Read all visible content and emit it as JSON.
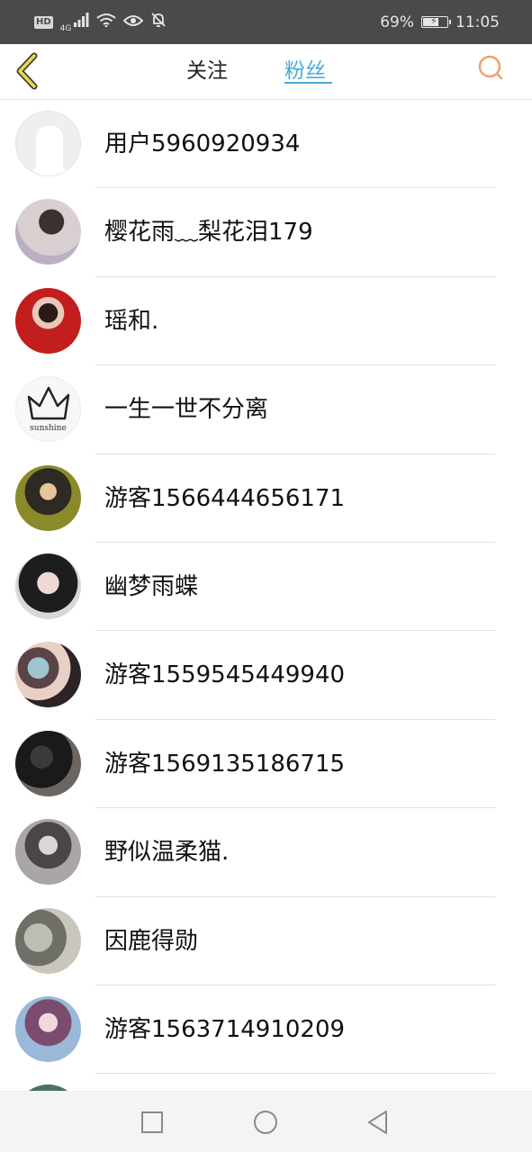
{
  "status_bar": {
    "left_badge": "HD",
    "network": "4G",
    "battery": "69%",
    "battery_fraction": 0.69,
    "time": "11:05",
    "icons": [
      "hd-icon",
      "signal-icon",
      "wifi-icon",
      "eye-icon",
      "mute-bell-icon",
      "battery-icon"
    ]
  },
  "nav": {
    "back_icon": "chevron-left-icon",
    "tabs": [
      {
        "label": "关注",
        "active": false
      },
      {
        "label": "粉丝",
        "active": true
      }
    ],
    "search_icon": "search-icon",
    "accent_color": "#4aaad7",
    "back_color": "#e8d94a",
    "search_color": "#f0a070"
  },
  "fans": [
    {
      "name": "用户5960920934",
      "avatar": "default-avatar-icon"
    },
    {
      "name": "樱花雨﹏梨花泪179",
      "avatar": "user-avatar"
    },
    {
      "name": "瑶和.",
      "avatar": "user-avatar"
    },
    {
      "name": "一生一世不分离",
      "avatar": "crown-avatar",
      "avatar_text": "sunshine"
    },
    {
      "name": "游客1566444656171",
      "avatar": "user-avatar"
    },
    {
      "name": "幽梦雨蝶",
      "avatar": "user-avatar"
    },
    {
      "name": "游客1559545449940",
      "avatar": "user-avatar"
    },
    {
      "name": "游客1569135186715",
      "avatar": "user-avatar"
    },
    {
      "name": "野似温柔猫.",
      "avatar": "user-avatar"
    },
    {
      "name": "因鹿得勋",
      "avatar": "user-avatar"
    },
    {
      "name": "游客1563714910209",
      "avatar": "user-avatar"
    },
    {
      "name": "",
      "avatar": "user-avatar"
    }
  ],
  "system_nav": {
    "icons": [
      "recent-apps-icon",
      "home-icon",
      "back-icon"
    ]
  }
}
